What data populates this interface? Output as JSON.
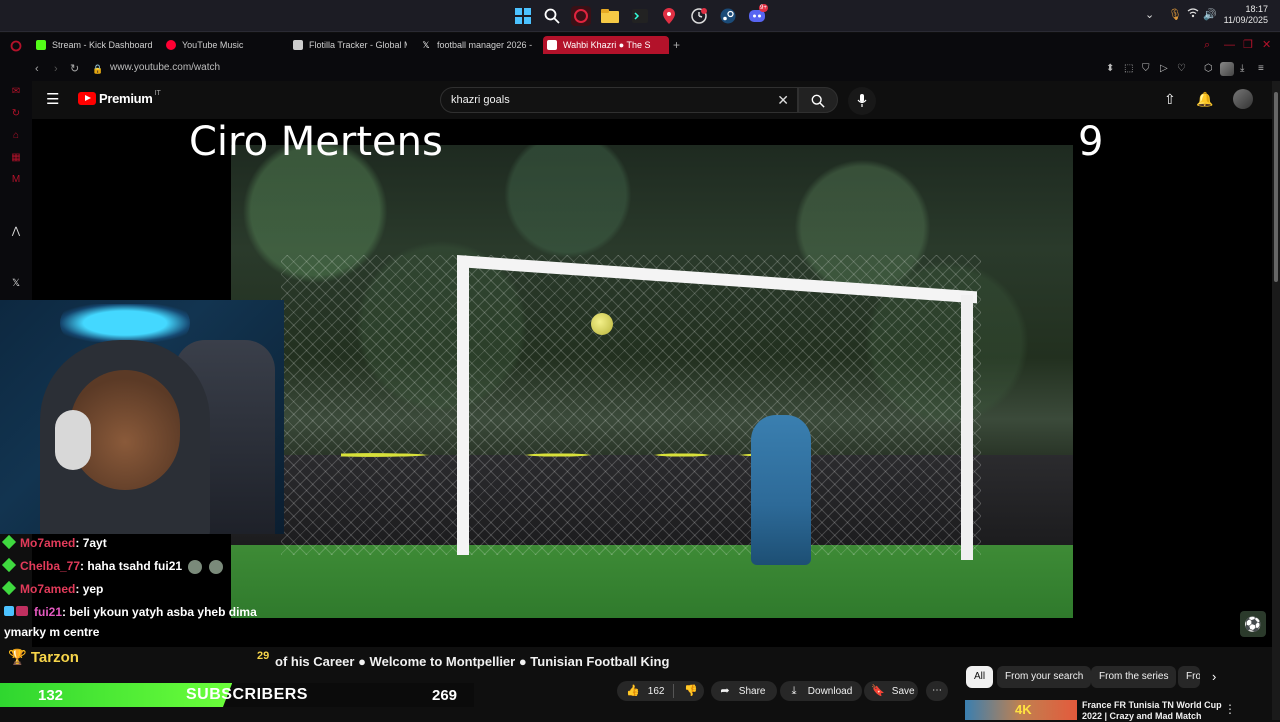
{
  "taskbar": {
    "icons": [
      "windows-start",
      "search",
      "opera-gx",
      "file-explorer",
      "terminal",
      "maps-pin",
      "clock-app",
      "steam",
      "discord"
    ],
    "discord_badge": "9+",
    "clock_time": "18:17",
    "clock_date": "11/09/2025"
  },
  "browser": {
    "tabs": [
      {
        "label": "Stream - Kick Dashboard",
        "icon_color": "#53fc18"
      },
      {
        "label": "YouTube Music",
        "icon_color": "#ff0033"
      },
      {
        "label": "Flotilla Tracker - Global M",
        "icon_color": "#cccccc"
      },
      {
        "label": "football manager 2026 -",
        "icon_color": "#ffffff"
      },
      {
        "label": "Wahbi Khazri ● The S",
        "icon_color": "#ff0033",
        "active": true
      }
    ],
    "new_tab": "+",
    "url": "www.youtube.com/watch"
  },
  "youtube": {
    "logo_text": "Premium",
    "country_code": "IT",
    "search_value": "khazri goals",
    "accent": "#ff0000"
  },
  "video": {
    "overlay_name": "Ciro Mertens",
    "overlay_rank": "9",
    "title_number": "29",
    "title": "of his Career ● Welcome to Montpellier ● Tunisian Football King"
  },
  "chat": [
    {
      "user": "Mo7amed",
      "message": ": 7ayt"
    },
    {
      "user": "Chelba_77",
      "message": ": haha tsahd fui21"
    },
    {
      "user": "Mo7amed",
      "message": ": yep"
    },
    {
      "user": "fui21",
      "message": ": beli ykoun yatyh asba yheb dima"
    },
    {
      "user": "",
      "message": "ymarky m centre"
    }
  ],
  "stream_overlay": {
    "top_user": "Tarzon",
    "sub_count": "132",
    "sub_label": "SUBSCRIBERS",
    "sub_goal": "269",
    "sub_progress": 0.49
  },
  "actions": {
    "likes": "162",
    "share": "Share",
    "download": "Download",
    "save": "Save"
  },
  "chips": [
    "All",
    "From your search",
    "From the series",
    "Fro"
  ],
  "recommendation": {
    "thumb_text": "4K",
    "title": "France FR Tunisia TN World Cup 2022 | Crazy and Mad Match"
  }
}
